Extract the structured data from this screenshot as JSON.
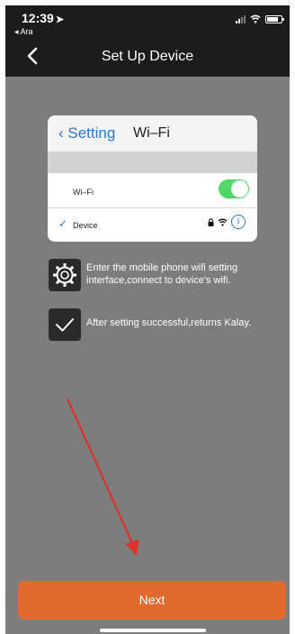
{
  "status_bar": {
    "time": "12:39",
    "back_app": "◂ Ara"
  },
  "nav": {
    "title": "Set Up Device"
  },
  "illustration": {
    "back_label": "Setting",
    "title": "Wi–Fi",
    "wifi_label": "Wi–Fi",
    "device_label": "Device",
    "wifi_toggle_on": true
  },
  "steps": [
    {
      "icon": "gear-icon",
      "text": "Enter the mobile phone wifi setting interface,connect to device's wifi."
    },
    {
      "icon": "checkmark-icon",
      "text": "After setting successful,returns Kalay."
    }
  ],
  "next_button": {
    "label": "Next"
  },
  "colors": {
    "nav_background": "#1c1c1c",
    "page_background": "#7d7d7d",
    "accent": "#e06a2e",
    "ios_blue": "#2b77d1",
    "toggle_green": "#4cd964",
    "annotation_arrow": "#d9342b"
  }
}
